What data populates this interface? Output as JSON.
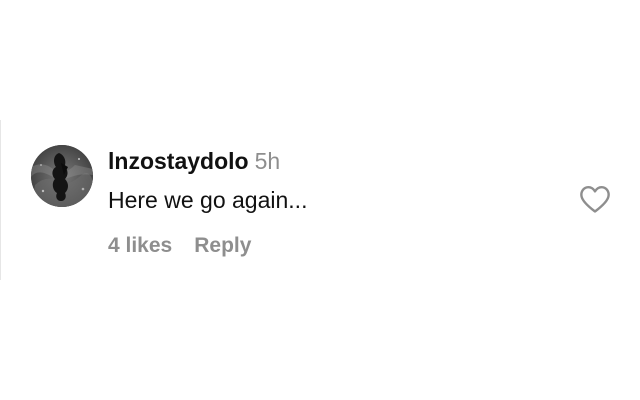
{
  "comment": {
    "username": "lnzostaydolo",
    "timestamp": "5h",
    "text": "Here we go again...",
    "likes_label": "4 likes",
    "reply_label": "Reply"
  },
  "icons": {
    "avatar": "profile-avatar",
    "like": "heart-outline-icon"
  },
  "colors": {
    "primary_text": "#111111",
    "secondary_text": "#8e8e8e",
    "heart_stroke": "#8e8e8e",
    "background": "#ffffff"
  }
}
